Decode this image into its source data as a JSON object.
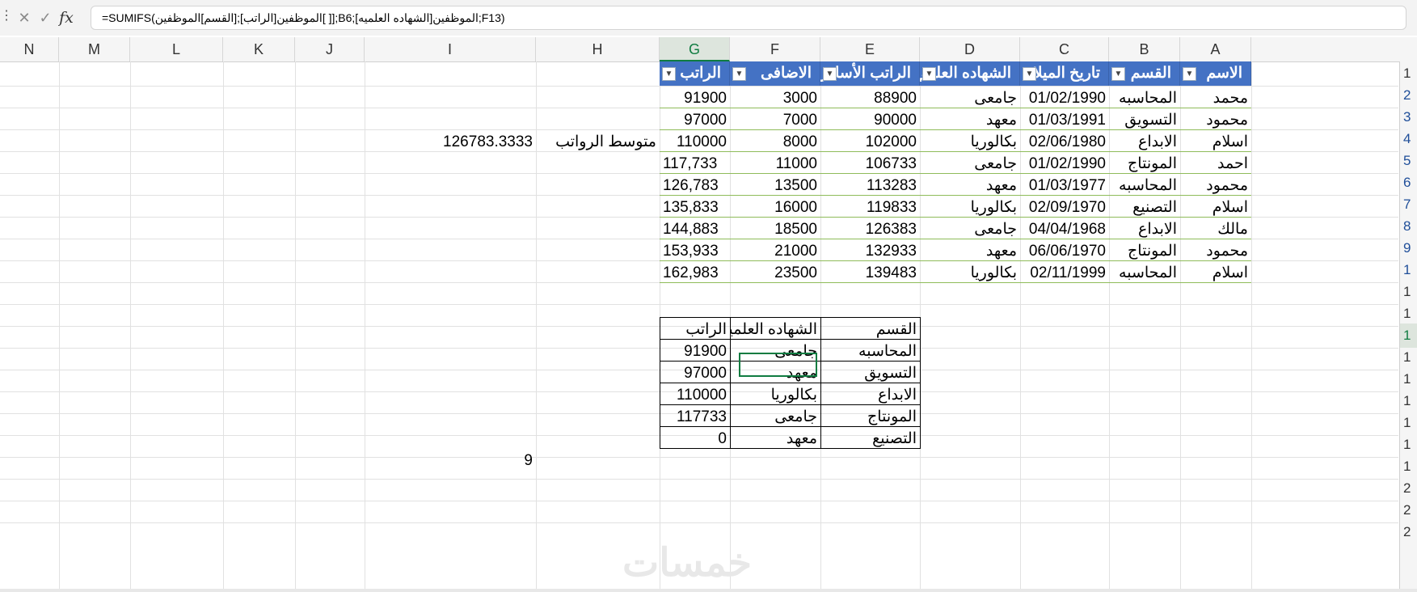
{
  "formula_bar": {
    "cancel_icon": "x-icon",
    "enter_icon": "check-icon",
    "fx_label": "fx",
    "formula": "=SUMIFS(الموظفين[الراتب];[القسم]الموظفين[ ]];B6;الموظفين[الشهاده العلميه];F13)"
  },
  "columns": [
    "N",
    "M",
    "L",
    "K",
    "J",
    "I",
    "H",
    "G",
    "F",
    "E",
    "D",
    "C",
    "B",
    "A"
  ],
  "selected_column": "G",
  "rows": [
    "1",
    "2",
    "3",
    "4",
    "5",
    "6",
    "7",
    "8",
    "9",
    "1",
    "1",
    "1",
    "1",
    "1",
    "1",
    "1",
    "1",
    "1",
    "1",
    "2",
    "2",
    "2"
  ],
  "table": {
    "headers": {
      "name": "الاسم",
      "dept": "القسم",
      "birth": "تاريخ الميلا",
      "degree": "الشهاده العلمي",
      "base": "الراتب الأساس",
      "extra": "الاضافى",
      "salary": "الراتب"
    },
    "rows": [
      {
        "name": "محمد",
        "dept": "المحاسبه",
        "birth": "01/02/1990",
        "degree": "جامعى",
        "base": "88900",
        "extra": "3000",
        "salary": "91900"
      },
      {
        "name": "محمود",
        "dept": "التسويق",
        "birth": "01/03/1991",
        "degree": "معهد",
        "base": "90000",
        "extra": "7000",
        "salary": "97000"
      },
      {
        "name": "اسلام",
        "dept": "الابداع",
        "birth": "02/06/1980",
        "degree": "بكالوريا",
        "base": "102000",
        "extra": "8000",
        "salary": "110000"
      },
      {
        "name": "احمد",
        "dept": "المونتاج",
        "birth": "01/02/1990",
        "degree": "جامعى",
        "base": "106733",
        "extra": "11000",
        "salary": "117,733"
      },
      {
        "name": "محمود",
        "dept": "المحاسبه",
        "birth": "01/03/1977",
        "degree": "معهد",
        "base": "113283",
        "extra": "13500",
        "salary": "126,783"
      },
      {
        "name": "اسلام",
        "dept": "التصنيع",
        "birth": "02/09/1970",
        "degree": "بكالوريا",
        "base": "119833",
        "extra": "16000",
        "salary": "135,833"
      },
      {
        "name": "مالك",
        "dept": "الابداع",
        "birth": "04/04/1968",
        "degree": "جامعى",
        "base": "126383",
        "extra": "18500",
        "salary": "144,883"
      },
      {
        "name": "محمود",
        "dept": "المونتاج",
        "birth": "06/06/1970",
        "degree": "معهد",
        "base": "132933",
        "extra": "21000",
        "salary": "153,933"
      },
      {
        "name": "اسلام",
        "dept": "المحاسبه",
        "birth": "02/11/1999",
        "degree": "بكالوريا",
        "base": "139483",
        "extra": "23500",
        "salary": "162,983"
      }
    ]
  },
  "average": {
    "label": "متوسط الرواتب",
    "value": "126783.3333"
  },
  "summary": {
    "headers": {
      "dept": "القسم",
      "degree": "الشهاده العلميه",
      "salary": "الراتب"
    },
    "rows": [
      {
        "dept": "المحاسبه",
        "degree": "جامعى",
        "salary": "91900"
      },
      {
        "dept": "التسويق",
        "degree": "معهد",
        "salary": "97000"
      },
      {
        "dept": "الابداع",
        "degree": "بكالوريا",
        "salary": "110000"
      },
      {
        "dept": "المونتاج",
        "degree": "جامعى",
        "salary": "117733"
      },
      {
        "dept": "التصنيع",
        "degree": "معهد",
        "salary": "0"
      }
    ]
  },
  "count_value": "9",
  "watermark": "خمسات",
  "colors": {
    "header_blue": "#4472c4",
    "selection_green": "#107c41",
    "band_green": "#8fbc5a"
  }
}
